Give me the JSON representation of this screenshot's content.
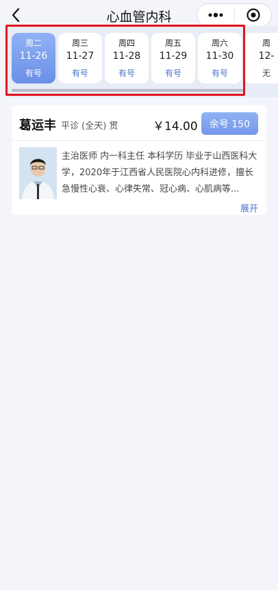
{
  "header": {
    "title": "心血管内科",
    "back_icon": "chevron-left-icon",
    "more_icon": "more-dots-icon",
    "target_icon": "target-icon"
  },
  "dates": [
    {
      "weekday": "周二",
      "date": "11-26",
      "status": "有号",
      "selected": true
    },
    {
      "weekday": "周三",
      "date": "11-27",
      "status": "有号",
      "selected": false
    },
    {
      "weekday": "周四",
      "date": "11-28",
      "status": "有号",
      "selected": false
    },
    {
      "weekday": "周五",
      "date": "11-29",
      "status": "有号",
      "selected": false
    },
    {
      "weekday": "周六",
      "date": "11-30",
      "status": "有号",
      "selected": false
    },
    {
      "weekday": "周",
      "date": "12-",
      "status": "无",
      "selected": false
    }
  ],
  "doctor": {
    "name": "葛运丰",
    "type": "平诊 (全天) 贯",
    "price": "￥14.00",
    "remain": "余号 150",
    "description": "主治医师 内一科主任 本科学历 毕业于山西医科大学，2020年于江西省人民医院心内科进修，擅长急慢性心衰、心律失常、冠心病、心肌病等...",
    "expand": "展开"
  },
  "colors": {
    "accent": "#6b8fe6",
    "link": "#4a72c8",
    "highlight": "#e0141e"
  }
}
